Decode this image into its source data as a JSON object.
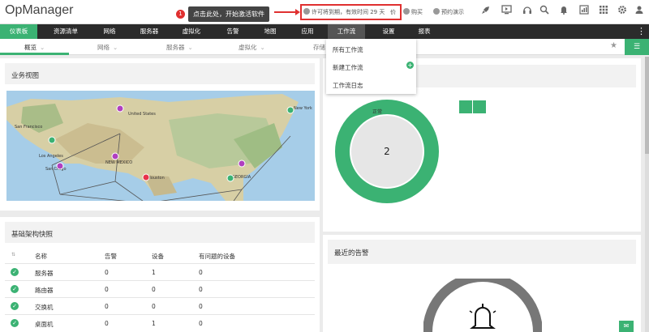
{
  "app": {
    "logo": "OpManager"
  },
  "tooltip": {
    "badge": "1",
    "text": "点击此处，开始激活软件"
  },
  "license": {
    "text": "许可将到期，有效时间 29 天"
  },
  "header_links": {
    "price": "价",
    "buy": "购买",
    "demo": "预约演示"
  },
  "header_icons": [
    "rocket-icon",
    "monitor-icon",
    "headset-icon",
    "search-icon",
    "bell-icon",
    "apps-grid-icon",
    "calendar-icon",
    "gear-icon",
    "user-icon"
  ],
  "nav": {
    "items": [
      {
        "label": "仪表板",
        "active": true
      },
      {
        "label": "资源清单"
      },
      {
        "label": "网络"
      },
      {
        "label": "服务器"
      },
      {
        "label": "虚拟化"
      },
      {
        "label": "告警"
      },
      {
        "label": "地图"
      },
      {
        "label": "应用"
      },
      {
        "label": "工作流",
        "hover": true
      },
      {
        "label": "设置"
      },
      {
        "label": "报表"
      }
    ]
  },
  "subnav": {
    "items": [
      {
        "label": "概览",
        "active": true
      },
      {
        "label": "网络"
      },
      {
        "label": "服务器"
      },
      {
        "label": "虚拟化"
      },
      {
        "label": "存储"
      }
    ]
  },
  "workflow_menu": {
    "items": [
      {
        "label": "所有工作流"
      },
      {
        "label": "新建工作流"
      },
      {
        "label": "工作流日志"
      }
    ]
  },
  "business_view": {
    "title": "业务视图",
    "map_labels": [
      "United States",
      "San Francisco",
      "Los Angeles",
      "San Diego",
      "New York",
      "NEW MEXICO",
      "Houston",
      "GEORGIA"
    ],
    "node_colors": {
      "green": "#3bb273",
      "purple": "#b03fc0",
      "red": "#e8334a"
    }
  },
  "status_widget": {
    "center_value": "2",
    "legend_label": "正常",
    "ring_color": "#3bb273"
  },
  "infra_snapshot": {
    "title": "基础架构快照",
    "columns": [
      "名称",
      "告警",
      "设备",
      "有问题的设备"
    ],
    "rows": [
      {
        "name": "服务器",
        "alarms": "0",
        "devices": "1",
        "problem": "0"
      },
      {
        "name": "路由器",
        "alarms": "0",
        "devices": "0",
        "problem": "0"
      },
      {
        "name": "交换机",
        "alarms": "0",
        "devices": "0",
        "problem": "0"
      },
      {
        "name": "桌面机",
        "alarms": "0",
        "devices": "1",
        "problem": "0"
      }
    ]
  },
  "recent_alarms": {
    "title": "最近的告警",
    "icon": "alarm-bell-icon"
  }
}
